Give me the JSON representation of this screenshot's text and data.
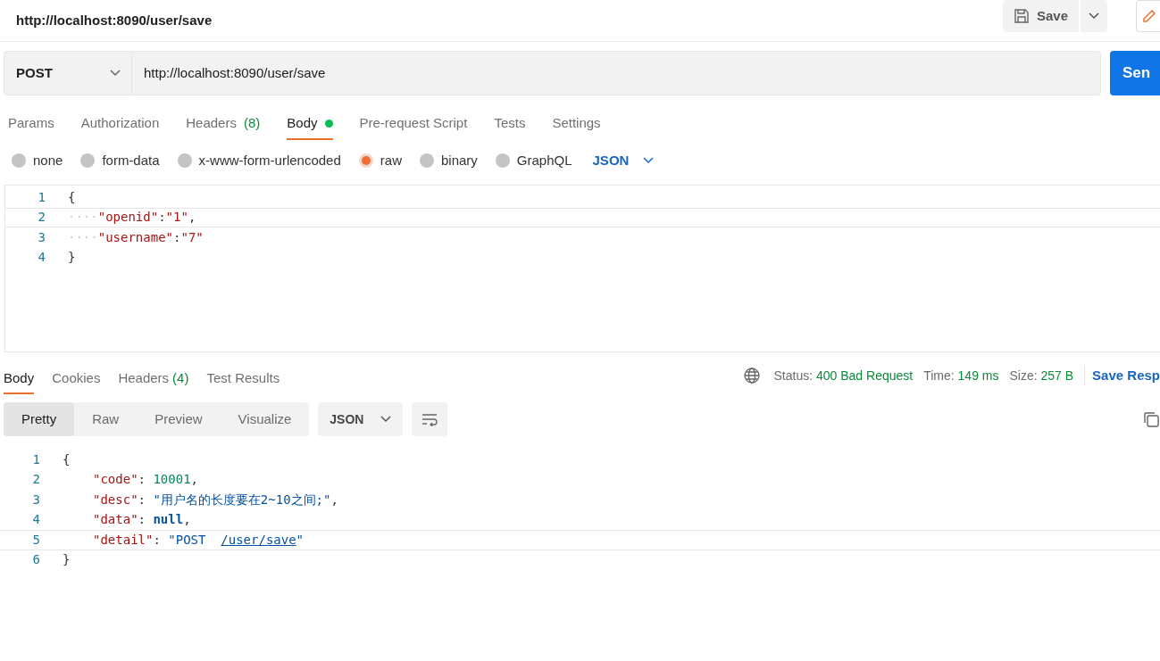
{
  "header": {
    "title": "http://localhost:8090/user/save",
    "save_label": "Save"
  },
  "request": {
    "method": "POST",
    "url": "http://localhost:8090/user/save",
    "send_label": "Sen"
  },
  "request_tabs": [
    {
      "label": "Params",
      "selected": false
    },
    {
      "label": "Authorization",
      "selected": false
    },
    {
      "label": "Headers",
      "count": "(8)",
      "selected": false
    },
    {
      "label": "Body",
      "dot": true,
      "selected": true
    },
    {
      "label": "Pre-request Script",
      "selected": false
    },
    {
      "label": "Tests",
      "selected": false
    },
    {
      "label": "Settings",
      "selected": false
    }
  ],
  "body_types": [
    {
      "label": "none",
      "selected": false
    },
    {
      "label": "form-data",
      "selected": false
    },
    {
      "label": "x-www-form-urlencoded",
      "selected": false
    },
    {
      "label": "raw",
      "selected": true
    },
    {
      "label": "binary",
      "selected": false
    },
    {
      "label": "GraphQL",
      "selected": false
    }
  ],
  "body_format": "JSON",
  "request_editor": [
    {
      "number": "1",
      "indent": false,
      "tokens": [
        {
          "t": "{",
          "kind": "brace"
        }
      ]
    },
    {
      "number": "2",
      "indent": false,
      "tokens": [
        {
          "t": "····",
          "kind": "ws"
        },
        {
          "t": "\"openid\"",
          "kind": "key"
        },
        {
          "t": ":",
          "kind": "punct"
        },
        {
          "t": "\"1\"",
          "kind": "string"
        },
        {
          "t": ",",
          "kind": "punct"
        }
      ]
    },
    {
      "number": "3",
      "indent": false,
      "tokens": [
        {
          "t": "····",
          "kind": "ws"
        },
        {
          "t": "\"username\"",
          "kind": "key"
        },
        {
          "t": ":",
          "kind": "punct"
        },
        {
          "t": "\"7\"",
          "kind": "string"
        }
      ]
    },
    {
      "number": "4",
      "indent": false,
      "tokens": [
        {
          "t": "}",
          "kind": "brace"
        }
      ]
    }
  ],
  "response_tabs": [
    {
      "label": "Body",
      "selected": true
    },
    {
      "label": "Cookies",
      "selected": false
    },
    {
      "label": "Headers",
      "count": "(4)",
      "selected": false
    },
    {
      "label": "Test Results",
      "selected": false
    }
  ],
  "status": [
    {
      "label": "Status:",
      "value": "400 Bad Request"
    },
    {
      "label": "Time:",
      "value": "149 ms"
    },
    {
      "label": "Size:",
      "value": "257 B"
    }
  ],
  "save_response": "Save Resp",
  "view_modes": [
    {
      "label": "Pretty",
      "selected": true
    },
    {
      "label": "Raw",
      "selected": false
    },
    {
      "label": "Preview",
      "selected": false
    },
    {
      "label": "Visualize",
      "selected": false
    }
  ],
  "response_format": "JSON",
  "response_editor": [
    {
      "number": "1",
      "indent": false,
      "tokens": [
        {
          "t": "{",
          "kind": "brace"
        }
      ]
    },
    {
      "number": "2",
      "indent": true,
      "tokens": [
        {
          "t": "\"code\"",
          "kind": "key"
        },
        {
          "t": ": ",
          "kind": "punct"
        },
        {
          "t": "10001",
          "kind": "number"
        },
        {
          "t": ",",
          "kind": "punct"
        }
      ]
    },
    {
      "number": "3",
      "indent": true,
      "tokens": [
        {
          "t": "\"desc\"",
          "kind": "key"
        },
        {
          "t": ": ",
          "kind": "punct"
        },
        {
          "t": "\"用户名的长度要在2~10之间;\"",
          "kind": "string"
        },
        {
          "t": ",",
          "kind": "punct"
        }
      ]
    },
    {
      "number": "4",
      "indent": true,
      "tokens": [
        {
          "t": "\"data\"",
          "kind": "key"
        },
        {
          "t": ": ",
          "kind": "punct"
        },
        {
          "t": "null",
          "kind": "keyword"
        },
        {
          "t": ",",
          "kind": "punct"
        }
      ]
    },
    {
      "number": "5",
      "indent": true,
      "tokens": [
        {
          "t": "\"detail\"",
          "kind": "key"
        },
        {
          "t": ": ",
          "kind": "punct"
        },
        {
          "t": "\"POST  ",
          "kind": "string"
        },
        {
          "t": "/user/save",
          "kind": "link"
        },
        {
          "t": "\"",
          "kind": "string"
        }
      ]
    },
    {
      "number": "6",
      "indent": false,
      "tokens": [
        {
          "t": "}",
          "kind": "brace"
        }
      ]
    }
  ]
}
